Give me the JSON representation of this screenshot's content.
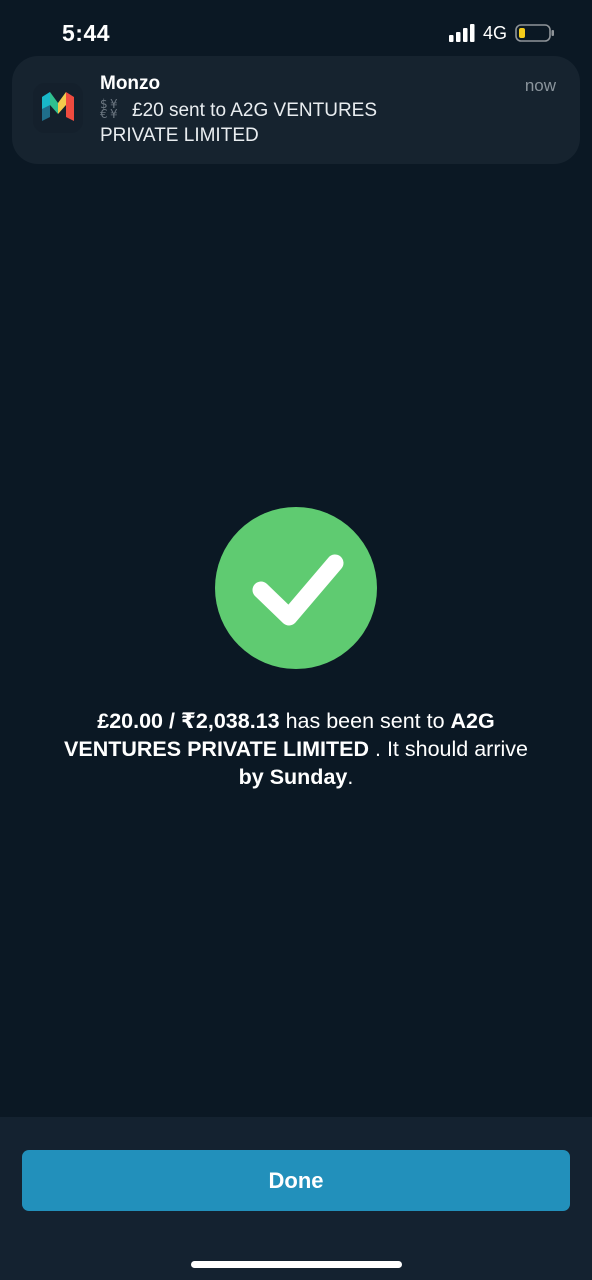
{
  "status_bar": {
    "time": "5:44",
    "network": "4G",
    "signal_icon": "cellular-signal-icon",
    "battery_icon": "battery-low-icon",
    "battery_color": "#f5cc1a"
  },
  "notification": {
    "app_name": "Monzo",
    "time": "now",
    "body": "£20 sent to A2G VENTURES PRIVATE LIMITED",
    "app_icon": "monzo-logo-icon",
    "body_icon": "money-exchange-icon"
  },
  "success": {
    "icon": "checkmark-icon",
    "color": "#5fcb71",
    "amounts": "£20.00 / ₹2,038.13",
    "text_sent": " has been sent to ",
    "recipient": "A2G VENTURES PRIVATE LIMITED",
    "text_arrive": " . It should arrive ",
    "arrival": "by Sunday",
    "end": "."
  },
  "actions": {
    "done_label": "Done",
    "accent_color": "#2290bb"
  }
}
